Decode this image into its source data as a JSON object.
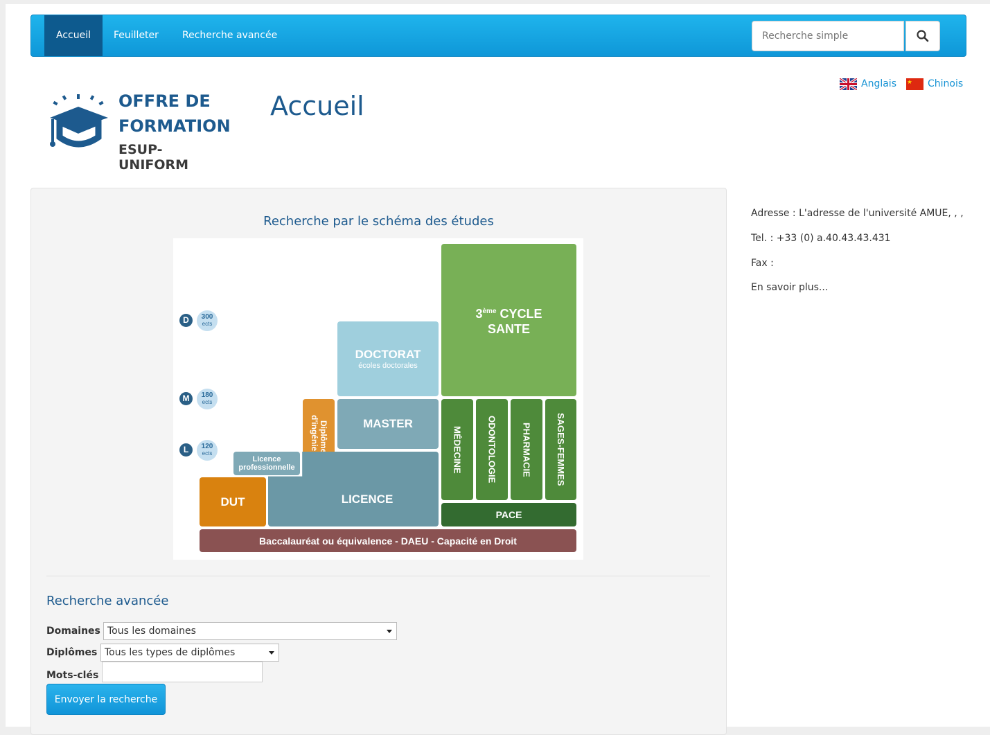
{
  "nav": {
    "items": [
      {
        "label": "Accueil",
        "active": true
      },
      {
        "label": "Feuilleter",
        "active": false
      },
      {
        "label": "Recherche avancée",
        "active": false
      }
    ],
    "search_placeholder": "Recherche simple",
    "search_icon": "search-icon"
  },
  "header": {
    "logo": {
      "line1": "OFFRE DE",
      "line2": "FORMATION",
      "line3": "ESUP-UNIFORM"
    },
    "title": "Accueil",
    "languages": [
      {
        "label": "Anglais",
        "flag": "uk-flag"
      },
      {
        "label": "Chinois",
        "flag": "china-flag"
      }
    ]
  },
  "schema": {
    "title": "Recherche par le schéma des études",
    "levels": [
      {
        "letter": "D",
        "ects": "300",
        "unit": "ects"
      },
      {
        "letter": "M",
        "ects": "180",
        "unit": "ects"
      },
      {
        "letter": "L",
        "ects": "120",
        "unit": "ects"
      }
    ],
    "blocks": {
      "cycle_sante_sup": "ème",
      "cycle_sante_pre": "3",
      "cycle_sante_line1": "CYCLE",
      "cycle_sante_line2": "SANTE",
      "doctorat": "DOCTORAT",
      "doctorat_sub": "écoles doctorales",
      "master": "MASTER",
      "diplome_ingenieur": "Diplôme d'ingénieur",
      "licence_pro": "Licence professionnelle",
      "licence": "LICENCE",
      "dut": "DUT",
      "medecine": "MÉDECINE",
      "odontologie": "ODONTOLOGIE",
      "pharmacie": "PHARMACIE",
      "sages_femmes": "SAGES-FEMMES",
      "pace": "PACE",
      "bac": "Baccalauréat ou équivalence - DAEU - Capacité en Droit"
    },
    "colors": {
      "sante": "#78b056",
      "sante_dark": "#4e8a3a",
      "pace": "#336b30",
      "doctorat": "#9fcfdd",
      "master": "#7fa9b6",
      "licence": "#6b98a6",
      "orange": "#e0922f",
      "dut": "#d9820f",
      "bac": "#8a5252"
    }
  },
  "advanced": {
    "title": "Recherche avancée",
    "domaines_label": "Domaines :",
    "domaines_value": "Tous les domaines",
    "diplomes_label": "Diplômes :",
    "diplomes_value": "Tous les types de diplômes",
    "keywords_label": "Mots-clés :",
    "keywords_value": "",
    "submit_label": "Envoyer la recherche"
  },
  "sidebar": {
    "address": "Adresse : L'adresse de l'université AMUE, , ,",
    "tel": "Tel. : +33 (0) a.40.43.43.431",
    "fax": "Fax :",
    "more": "En savoir plus..."
  }
}
